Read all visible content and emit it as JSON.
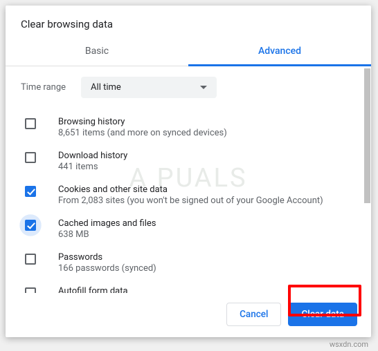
{
  "dialog": {
    "title": "Clear browsing data",
    "tabs": {
      "basic": "Basic",
      "advanced": "Advanced",
      "active": "advanced"
    },
    "time_range": {
      "label": "Time range",
      "value": "All time"
    },
    "items": [
      {
        "title": "Browsing history",
        "sub": "8,651 items (and more on synced devices)",
        "checked": false
      },
      {
        "title": "Download history",
        "sub": "441 items",
        "checked": false
      },
      {
        "title": "Cookies and other site data",
        "sub": "From 2,083 sites (you won't be signed out of your Google Account)",
        "checked": true
      },
      {
        "title": "Cached images and files",
        "sub": "638 MB",
        "checked": true,
        "focused": true
      },
      {
        "title": "Passwords",
        "sub": "166 passwords (synced)",
        "checked": false
      },
      {
        "title": "Autofill form data",
        "sub": "",
        "checked": false
      }
    ],
    "buttons": {
      "cancel": "Cancel",
      "clear": "Clear data"
    }
  },
  "watermark": "A   PUALS",
  "credit": "wsxdn.com"
}
